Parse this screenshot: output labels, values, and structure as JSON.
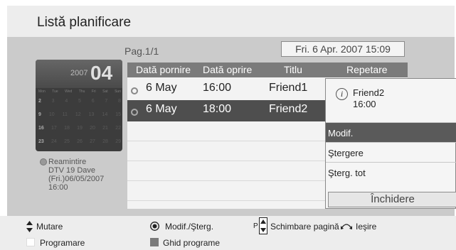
{
  "title": "Listă planificare",
  "page_indicator": "Pag.1/1",
  "current_date": "Fri. 6 Apr. 2007 15:09",
  "calendar": {
    "year": "2007",
    "month": "04",
    "day_names": [
      "Mon",
      "Tue",
      "Wed",
      "Thu",
      "Fri",
      "Sat",
      "Sun"
    ],
    "weeks": [
      [
        "2",
        "3",
        "4",
        "5",
        "6",
        "7",
        "8"
      ],
      [
        "9",
        "10",
        "11",
        "12",
        "13",
        "14",
        "15"
      ],
      [
        "16",
        "17",
        "18",
        "19",
        "20",
        "21",
        "22"
      ],
      [
        "23",
        "24",
        "25",
        "26",
        "27",
        "28",
        "29"
      ]
    ]
  },
  "reminder": {
    "lines": [
      "Reamintire",
      "DTV 19 Dave",
      "(Fri.)06/05/2007",
      "16:00"
    ]
  },
  "table": {
    "headers": [
      "Dată pornire",
      "Dată oprire",
      "Titlu",
      "Repetare"
    ],
    "rows": [
      {
        "start": "6 May",
        "stop": "16:00",
        "title": "Friend1"
      },
      {
        "start": "6 May",
        "stop": "18:00",
        "title": "Friend2"
      }
    ]
  },
  "popup": {
    "info_name": "Friend2",
    "info_time": "16:00",
    "menu": [
      "Modif.",
      "Ştergere",
      "Şterg. tot"
    ],
    "close_label": "Închidere"
  },
  "footer": {
    "move": "Mutare",
    "edit_delete": "Modif./Şterg.",
    "page_change_prefix": "P",
    "page_change": "Schimbare pagină",
    "exit": "Ieşire",
    "schedule": "Programare",
    "guide": "Ghid programe"
  },
  "colors": {
    "panel_bg": "#cbcbcb",
    "selected_row": "#4e4e4e",
    "active_menu": "#5a5a5a",
    "header_bg": "#7b7b7b"
  }
}
